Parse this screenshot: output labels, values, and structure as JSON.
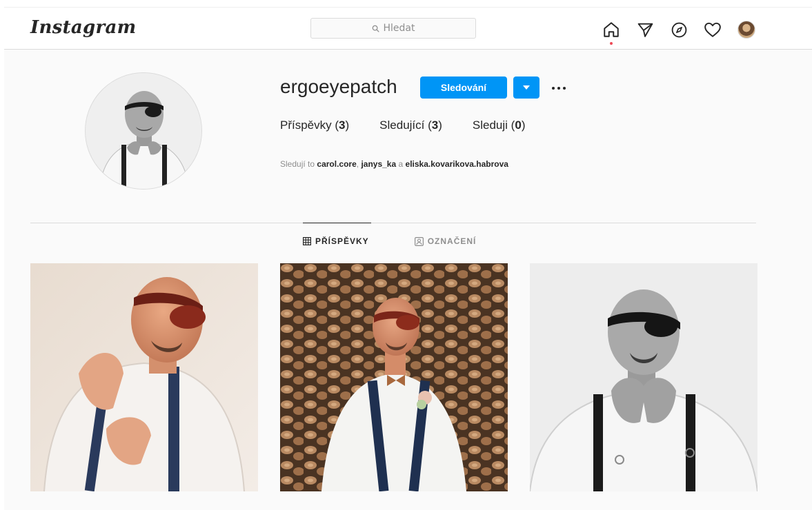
{
  "header": {
    "logo": "Instagram",
    "search_placeholder": "Hledat",
    "nav": [
      {
        "name": "home-icon"
      },
      {
        "name": "direct-icon"
      },
      {
        "name": "explore-icon"
      },
      {
        "name": "activity-icon"
      },
      {
        "name": "profile-avatar"
      }
    ]
  },
  "profile": {
    "username": "ergoeyepatch",
    "follow_label": "Sledování",
    "stats": [
      {
        "label": "Příspěvky",
        "count": "3"
      },
      {
        "label": "Sledující",
        "count": "3"
      },
      {
        "label": "Sleduji",
        "count": "0"
      }
    ],
    "followed_by": {
      "prefix": "Sledují to",
      "users": [
        "carol.core",
        "janys_ka",
        "eliska.kovarikova.habrova"
      ],
      "conjunction": "a"
    }
  },
  "tabs": [
    {
      "label": "PŘÍSPĚVKY",
      "active": true,
      "icon": "grid-icon"
    },
    {
      "label": "OZNAČENÍ",
      "active": false,
      "icon": "tagged-icon"
    }
  ],
  "colors": {
    "accent": "#0095f6",
    "notification_dot": "#ed4956",
    "text_primary": "#262626",
    "text_secondary": "#8e8e8e"
  }
}
